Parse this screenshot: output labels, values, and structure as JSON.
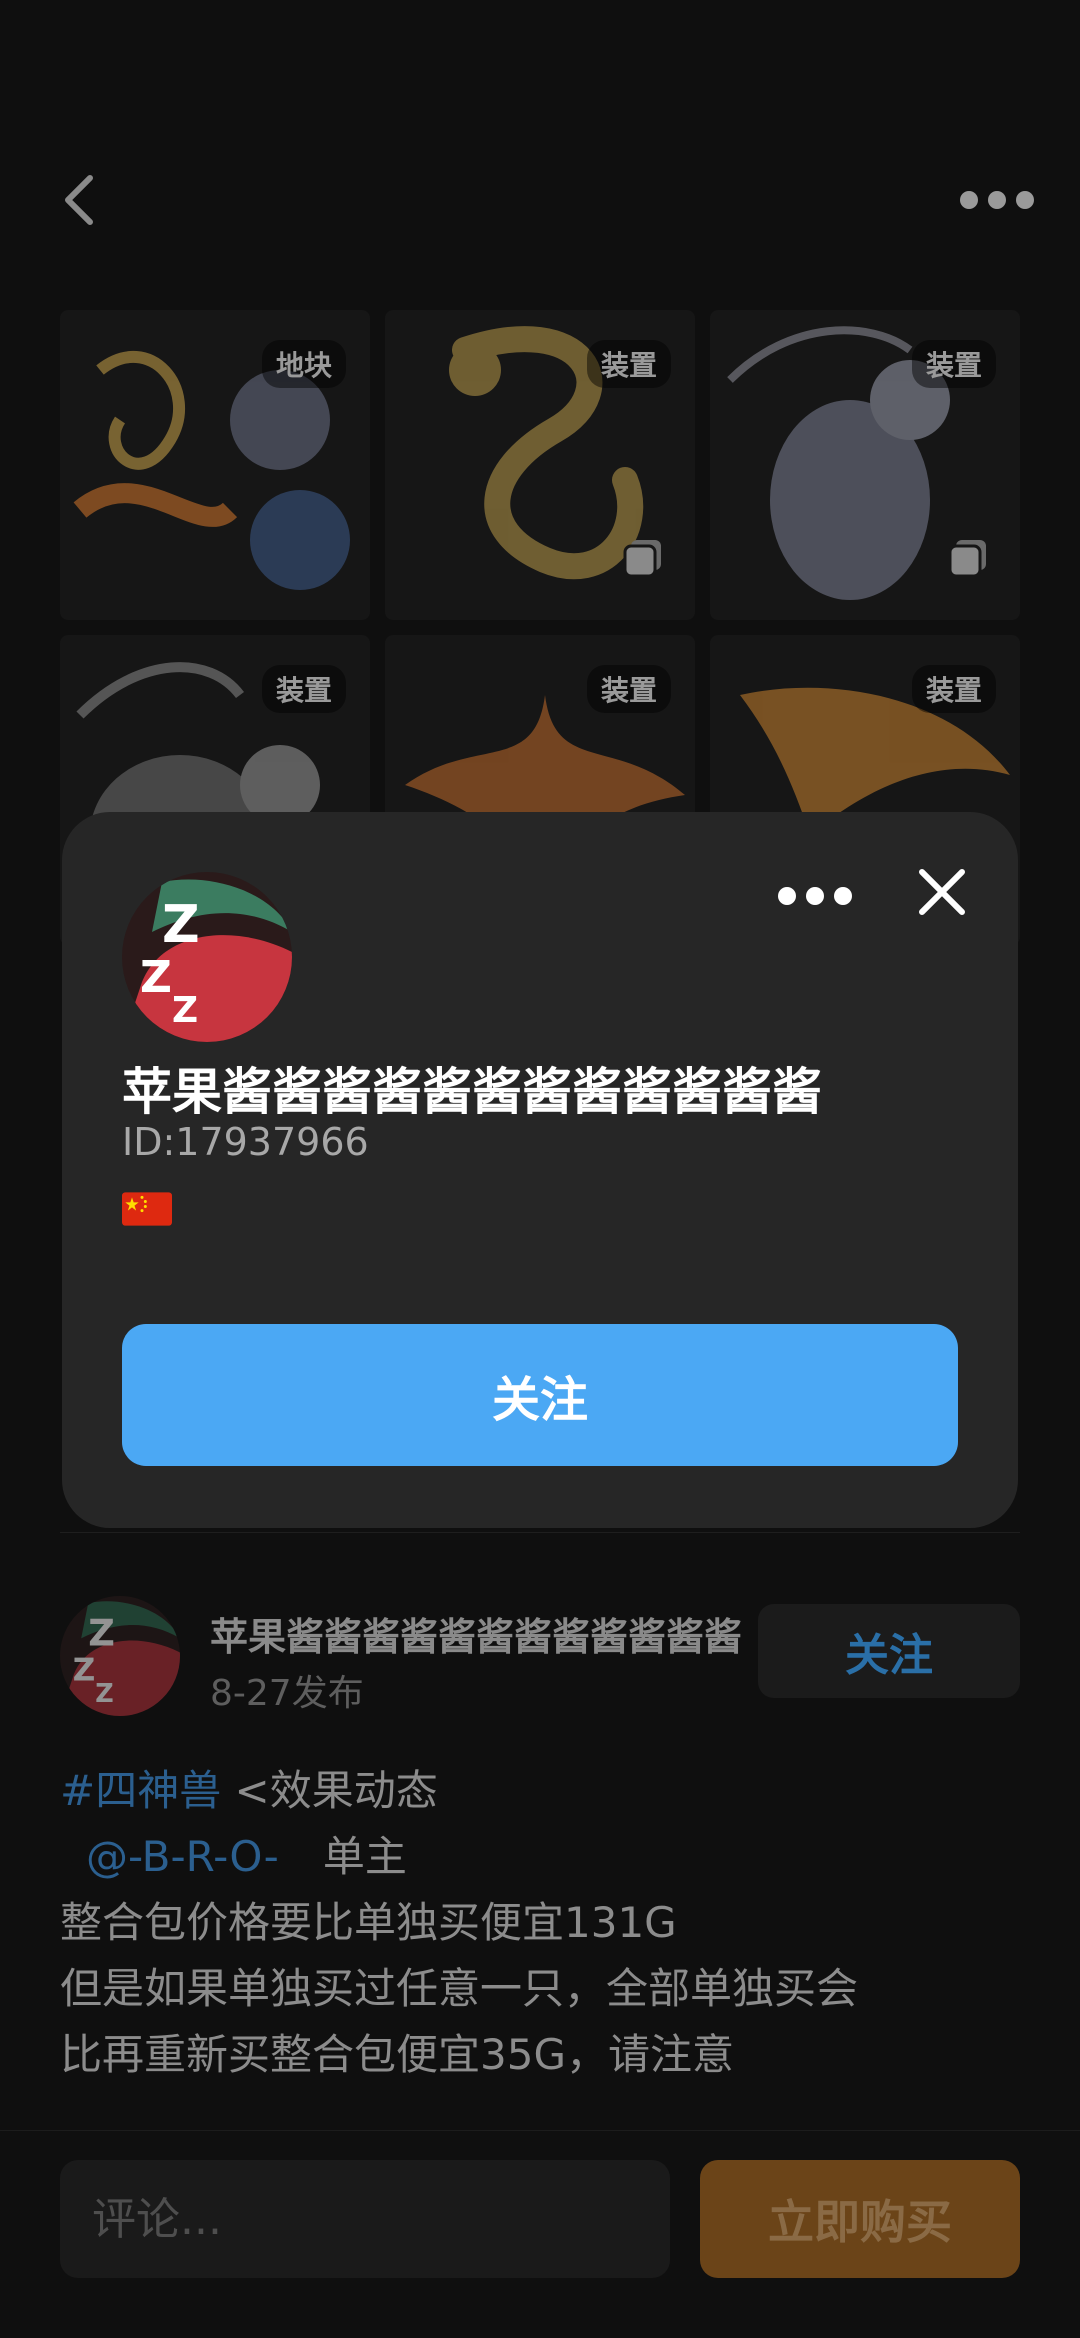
{
  "grid": {
    "tiles": [
      {
        "tag": "地块",
        "stacked": false,
        "art": "four-beasts"
      },
      {
        "tag": "装置",
        "stacked": true,
        "art": "golden-dragon"
      },
      {
        "tag": "装置",
        "stacked": true,
        "art": "white-tiger"
      },
      {
        "tag": "装置",
        "stacked": false,
        "art": "black-tortoise"
      },
      {
        "tag": "装置",
        "stacked": false,
        "art": "phoenix"
      },
      {
        "tag": "装置",
        "stacked": false,
        "art": "phoenix-wing"
      }
    ]
  },
  "author": {
    "name": "苹果酱酱酱酱酱酱酱酱酱酱酱酱",
    "date": "8-27发布",
    "follow_label": "关注"
  },
  "post": {
    "hashtag": "#四神兽",
    "line1_rest": " <效果动态",
    "mention": "@-B-R-O-",
    "line2_rest": "单主",
    "line3": "整合包价格要比单独买便宜131G",
    "line4": "但是如果单独买过任意一只，全部单独买会",
    "line5": "比再重新买整合包便宜35G，请注意"
  },
  "bottom": {
    "comment_placeholder": "评论...",
    "buy_label": "立即购买"
  },
  "modal": {
    "name": "苹果酱酱酱酱酱酱酱酱酱酱酱酱",
    "id": "ID:17937966",
    "flag_icon": "china-flag-icon",
    "follow_label": "关注"
  },
  "colors": {
    "accent": "#4ba8f4",
    "buy": "#6b4418",
    "modal_bg": "#262626"
  }
}
